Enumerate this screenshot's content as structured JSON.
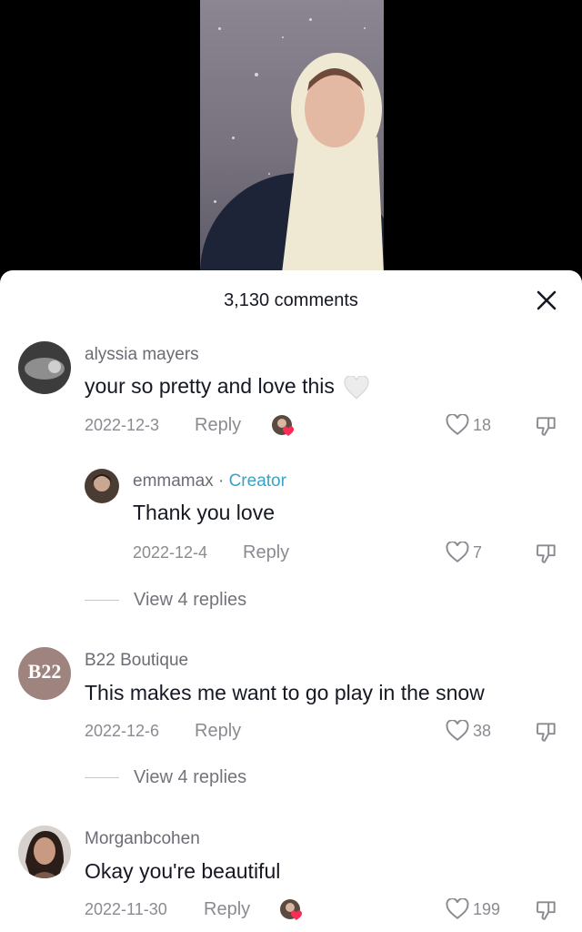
{
  "header": {
    "title": "3,130 comments"
  },
  "comments": [
    {
      "username": "alyssia mayers",
      "text": "your so pretty and love this",
      "date": "2022-12-3",
      "reply": "Reply",
      "likes": "18",
      "replies": [
        {
          "username": "emmamax",
          "badge": "Creator",
          "text": "Thank you love",
          "date": "2022-12-4",
          "reply": "Reply",
          "likes": "7"
        }
      ],
      "view_replies": "View 4 replies"
    },
    {
      "username": "B22 Boutique",
      "avatar_text": "B22",
      "text": "This makes me want to go play in the snow",
      "date": "2022-12-6",
      "reply": "Reply",
      "likes": "38",
      "view_replies": "View 4 replies"
    },
    {
      "username": "Morganbcohen",
      "text": "Okay you're beautiful",
      "date": "2022-11-30",
      "reply": "Reply",
      "likes": "199"
    }
  ],
  "colors": {
    "creator_badge": "#3aa2c4",
    "heart_badge": "#fe2c55",
    "b22_avatar": "#9e837f"
  }
}
